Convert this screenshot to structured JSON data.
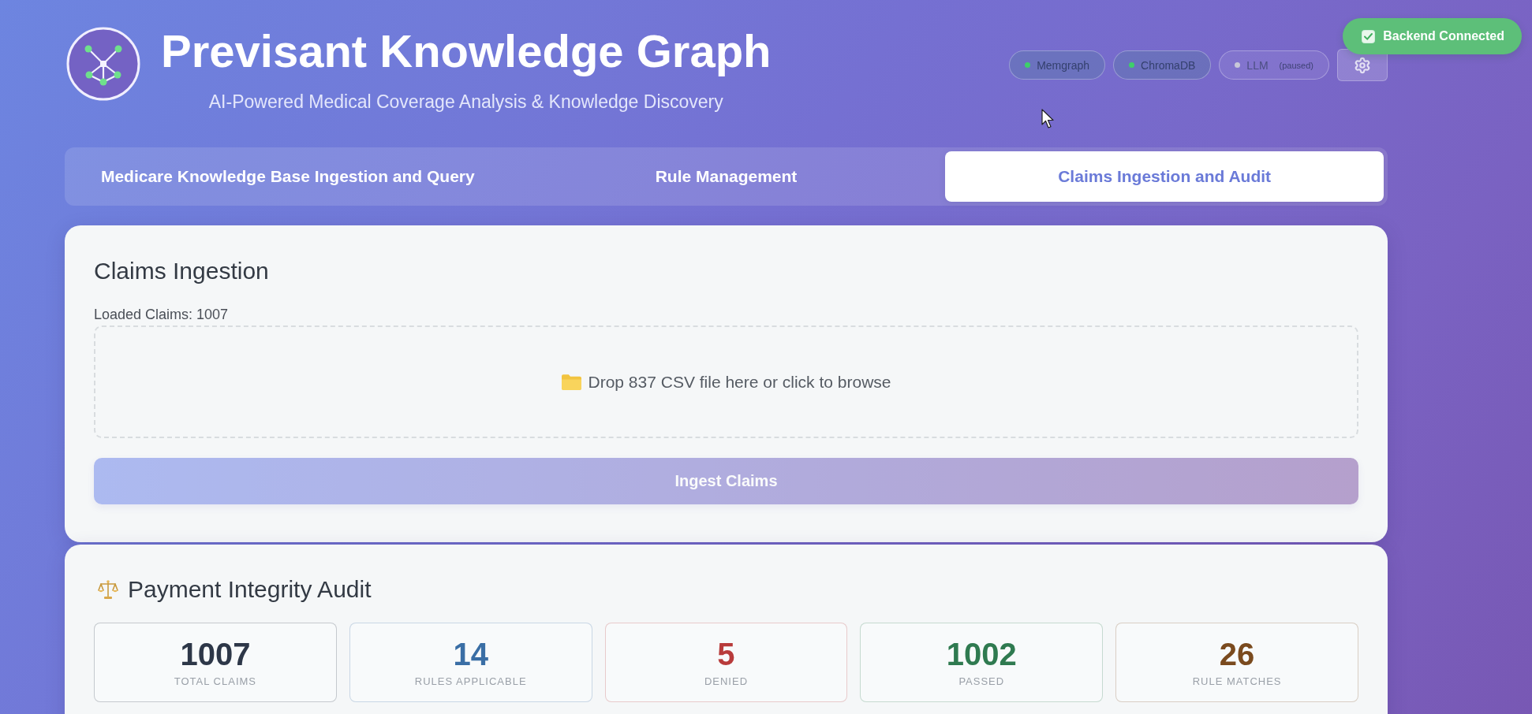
{
  "header": {
    "title": "Previsant Knowledge Graph",
    "subtitle": "AI-Powered Medical Coverage Analysis & Knowledge Discovery"
  },
  "services": [
    {
      "name": "Memgraph",
      "connected": true
    },
    {
      "name": "ChromaDB",
      "connected": true
    },
    {
      "name": "LLM",
      "note": "(paused)",
      "connected": false
    }
  ],
  "toast": {
    "message": "Backend Connected"
  },
  "tabs": [
    {
      "label": "Medicare Knowledge Base Ingestion and Query",
      "selected": false
    },
    {
      "label": "Rule Management",
      "selected": false
    },
    {
      "label": "Claims Ingestion and Audit",
      "selected": true
    }
  ],
  "ingestion": {
    "title": "Claims Ingestion",
    "loaded": "Loaded Claims: 1007",
    "dropzone": "Drop 837 CSV file here or click to browse",
    "button": {
      "label": "Ingest Claims",
      "disabled": true
    }
  },
  "audit": {
    "title": "Payment Integrity Audit",
    "stats": [
      {
        "value": "1007",
        "label": "TOTAL CLAIMS",
        "color": "#2d3748"
      },
      {
        "value": "14",
        "label": "RULES APPLICABLE",
        "color": "#3a6ea5"
      },
      {
        "value": "5",
        "label": "DENIED",
        "color": "#b83b3b"
      },
      {
        "value": "1002",
        "label": "PASSED",
        "color": "#2f7a50"
      },
      {
        "value": "26",
        "label": "RULE MATCHES",
        "color": "#7a4a1e"
      }
    ]
  }
}
